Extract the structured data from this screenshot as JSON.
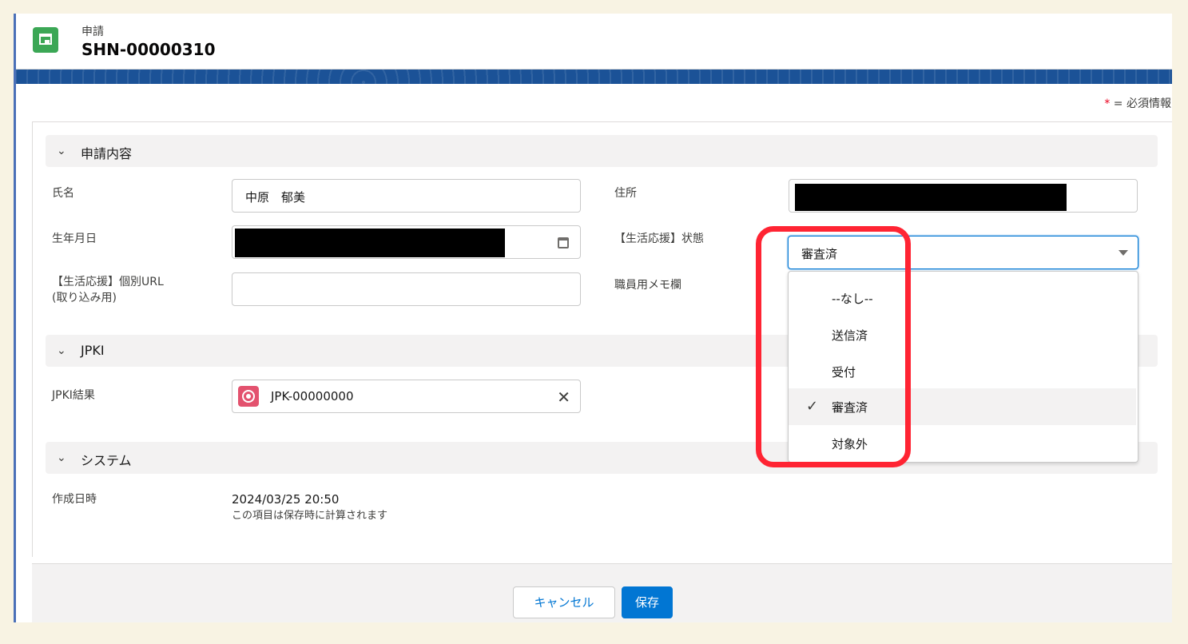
{
  "header": {
    "object_label": "申請",
    "record_name": "SHN-00000310"
  },
  "required_note": {
    "star": "*",
    "text": " = 必須情報"
  },
  "sections": [
    {
      "chevron": "⌄",
      "title": "申請内容"
    },
    {
      "chevron": "⌄",
      "title": "JPKI"
    },
    {
      "chevron": "⌄",
      "title": "システム"
    }
  ],
  "fields": {
    "name": {
      "label": "氏名",
      "value": "中原　郁美"
    },
    "address": {
      "label": "住所"
    },
    "birthdate": {
      "label": "生年月日"
    },
    "status": {
      "label": "【生活応援】状態",
      "value": "審査済"
    },
    "url": {
      "label_line1": "【生活応援】個別URL",
      "label_line2": "(取り込み用)",
      "value": ""
    },
    "memo": {
      "label": "職員用メモ欄"
    },
    "jpki": {
      "label": "JPKI結果",
      "value": "JPK-00000000"
    },
    "created": {
      "label": "作成日時",
      "value": "2024/03/25 20:50",
      "help": "この項目は保存時に計算されます"
    }
  },
  "status_options": [
    {
      "label": "--なし--",
      "selected": false
    },
    {
      "label": "送信済",
      "selected": false
    },
    {
      "label": "受付",
      "selected": false
    },
    {
      "label": "審査済",
      "selected": true
    },
    {
      "label": "対象外",
      "selected": false
    }
  ],
  "buttons": {
    "cancel": "キャンセル",
    "save": "保存"
  },
  "icons": {
    "record": "record-type-icon",
    "calendar": "calendar-icon",
    "lookup": "jpki-record-icon",
    "clear": "clear-icon",
    "check": "checkmark-icon",
    "caret": "dropdown-caret-icon"
  },
  "colors": {
    "brand": "#0176d3",
    "highlight": "#ff2433",
    "header_icon": "#3ba755"
  }
}
